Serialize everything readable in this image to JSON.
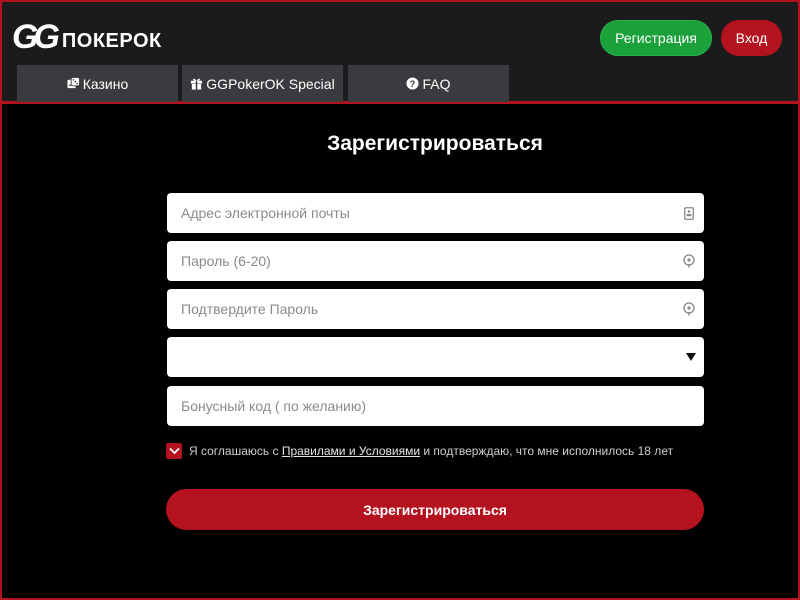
{
  "brand": {
    "logo_mark": "GG",
    "logo_word": "ПОКЕРОК"
  },
  "header": {
    "register_label": "Регистрация",
    "login_label": "Вход"
  },
  "tabs": [
    {
      "label": "Казино",
      "icon": "dice-icon"
    },
    {
      "label": "GGPokerOK Special",
      "icon": "gift-icon"
    },
    {
      "label": "FAQ",
      "icon": "question-circle-icon"
    }
  ],
  "form": {
    "title": "Зарегистрироваться",
    "email_placeholder": "Адрес электронной почты",
    "password_placeholder": "Пароль (6-20)",
    "confirm_placeholder": "Подтвердите Пароль",
    "select_value": "",
    "bonus_placeholder": "Бонусный код ( по желанию)",
    "agree_prefix": "Я соглашаюсь с ",
    "agree_link": "Правилами и Условиями",
    "agree_suffix": " и подтверждаю, что мне исполнилось 18 лет",
    "agree_checked": true,
    "submit_label": "Зарегистрироваться"
  },
  "colors": {
    "accent_red": "#b4121f",
    "register_green": "#1aa13a",
    "header_bg": "#1b1b1d",
    "tab_bg": "#3a3b3e",
    "page_bg": "#000000"
  }
}
